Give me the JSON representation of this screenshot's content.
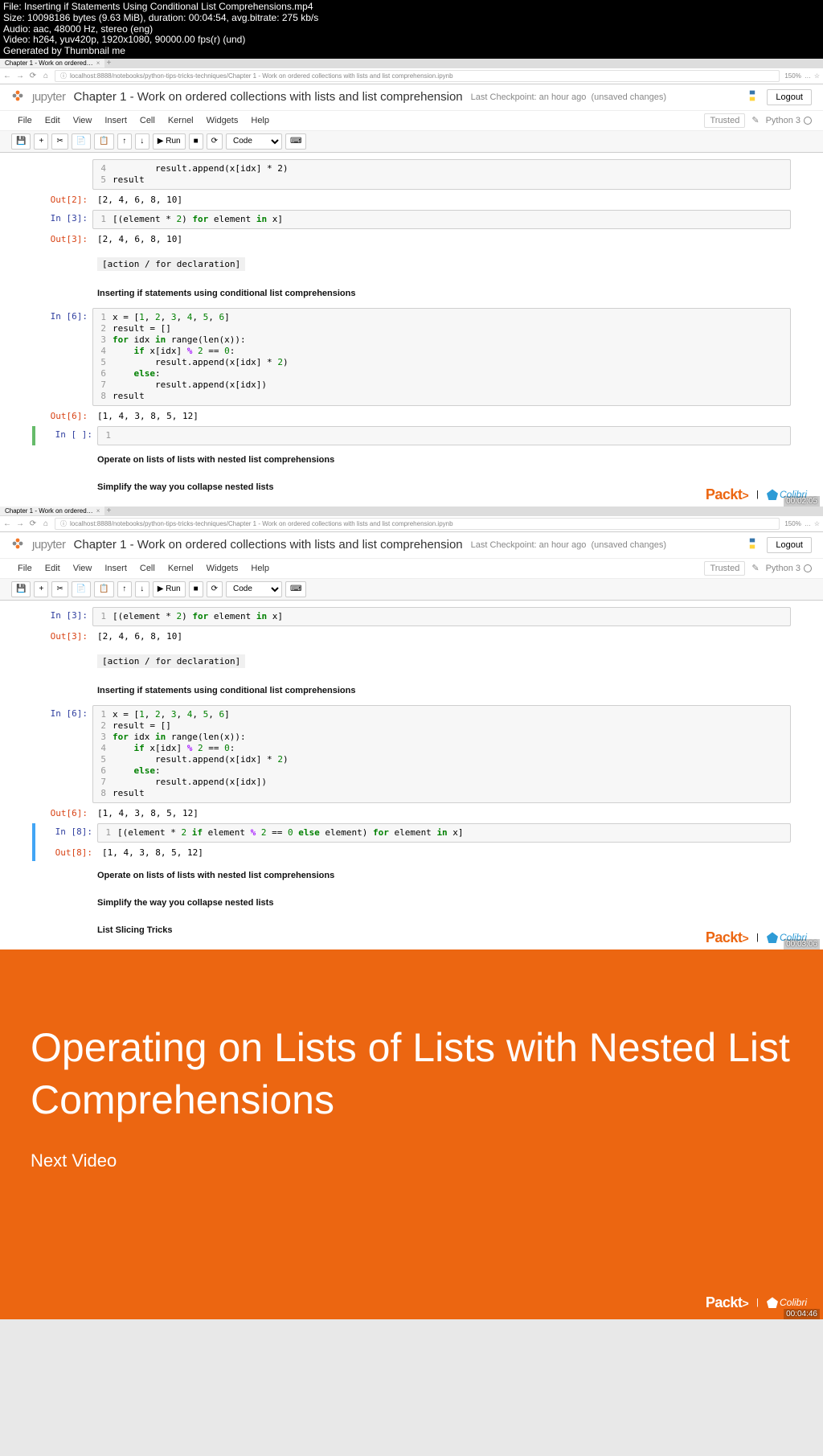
{
  "fileinfo": {
    "file": "File: Inserting if Statements Using Conditional List Comprehensions.mp4",
    "size": "Size: 10098186 bytes (9.63 MiB), duration: 00:04:54, avg.bitrate: 275 kb/s",
    "audio": "Audio: aac, 48000 Hz, stereo (eng)",
    "video": "Video: h264, yuv420p, 1920x1080, 90000.00 fps(r) (und)",
    "gen": "Generated by Thumbnail me"
  },
  "browser": {
    "tab_title": "Chapter 1 - Work on ordered…",
    "tab_close": "×",
    "url": "localhost:8888/notebooks/python-tips-tricks-techniques/Chapter 1 - Work on ordered collections with lists and list comprehension.ipynb",
    "zoom": "150%",
    "new_tab": "+"
  },
  "jupyter": {
    "logo_pre": "ȷupyter",
    "title": "Chapter 1 - Work on ordered collections with lists and list comprehension",
    "checkpoint": "Last Checkpoint: an hour ago",
    "unsaved": "(unsaved changes)",
    "logout": "Logout",
    "menu": [
      "File",
      "Edit",
      "View",
      "Insert",
      "Cell",
      "Kernel",
      "Widgets",
      "Help"
    ],
    "trusted": "Trusted",
    "kernel": "Python 3",
    "toolbar": {
      "run": "▶ Run",
      "cell_type": "Code"
    }
  },
  "shot1": {
    "timestamp": "00:02:05",
    "cell_partial": {
      "gutter": [
        "4",
        "5"
      ],
      "line4": "        result.append(x[idx] * 2)",
      "line5": "result"
    },
    "out2": {
      "prompt": "Out[2]:",
      "text": "[2, 4, 6, 8, 10]"
    },
    "in3": {
      "prompt": "In [3]:",
      "gutter": [
        "1"
      ],
      "line1a": "[(element * ",
      "line1b": "2",
      "line1c": ") ",
      "line1_for": "for",
      "line1d": " element ",
      "line1_in": "in",
      "line1e": " x]"
    },
    "out3": {
      "prompt": "Out[3]:",
      "text": "[2, 4, 6, 8, 10]"
    },
    "md1": "[action / for declaration]",
    "md2": "Inserting if statements using conditional list comprehensions",
    "in6": {
      "prompt": "In [6]:",
      "gutter": [
        "1",
        "2",
        "3",
        "4",
        "5",
        "6",
        "7",
        "8"
      ],
      "l1a": "x = [",
      "l1b": "1",
      "l1c": ", ",
      "l1d": "2",
      "l1e": ", ",
      "l1f": "3",
      "l1g": ", ",
      "l1h": "4",
      "l1i": ", ",
      "l1j": "5",
      "l1k": ", ",
      "l1l": "6",
      "l1m": "]",
      "l2": "result = []",
      "l3_for": "for",
      "l3a": " idx ",
      "l3_in": "in",
      "l3b": " range(len(x)):",
      "l4a": "    ",
      "l4_if": "if",
      "l4b": " x[idx] ",
      "l4_op": "%",
      "l4c": " ",
      "l4d": "2",
      "l4e": " == ",
      "l4f": "0",
      "l4g": ":",
      "l5a": "        result.append(x[idx] * ",
      "l5b": "2",
      "l5c": ")",
      "l6a": "    ",
      "l6_else": "else",
      "l6b": ":",
      "l7": "        result.append(x[idx])",
      "l8": "result"
    },
    "out6": {
      "prompt": "Out[6]:",
      "text": "[1, 4, 3, 8, 5, 12]"
    },
    "in_empty": {
      "prompt": "In [ ]:",
      "gutter": [
        "1"
      ],
      "line": ""
    },
    "md3": "Operate on lists of lists with nested list comprehensions",
    "md4": "Simplify the way you collapse nested lists"
  },
  "shot2": {
    "timestamp": "00:03:06",
    "in3": {
      "prompt": "In [3]:",
      "gutter": [
        "1"
      ],
      "line1a": "[(element * ",
      "line1b": "2",
      "line1c": ") ",
      "line1_for": "for",
      "line1d": " element ",
      "line1_in": "in",
      "line1e": " x]"
    },
    "out3": {
      "prompt": "Out[3]:",
      "text": "[2, 4, 6, 8, 10]"
    },
    "md1": "[action / for declaration]",
    "md2": "Inserting if statements using conditional list comprehensions",
    "in6": {
      "prompt": "In [6]:",
      "gutter": [
        "1",
        "2",
        "3",
        "4",
        "5",
        "6",
        "7",
        "8"
      ]
    },
    "out6": {
      "prompt": "Out[6]:",
      "text": "[1, 4, 3, 8, 5, 12]"
    },
    "in8": {
      "prompt": "In [8]:",
      "gutter": [
        "1"
      ],
      "l1a": "[(element * ",
      "l1b": "2",
      "l1c": " ",
      "l1_if": "if",
      "l1d": " element ",
      "l1_op": "%",
      "l1e": " ",
      "l1f": "2",
      "l1g": " == ",
      "l1h": "0",
      "l1i": " ",
      "l1_else": "else",
      "l1j": " element) ",
      "l1_for": "for",
      "l1k": " element ",
      "l1_in": "in",
      "l1l": " x]"
    },
    "out8": {
      "prompt": "Out[8]:",
      "text": "[1, 4, 3, 8, 5, 12]"
    },
    "md3": "Operate on lists of lists with nested list comprehensions",
    "md4": "Simplify the way you collapse nested lists",
    "md5": "List Slicing Tricks"
  },
  "slide": {
    "title": "Operating on Lists of Lists with Nested List Comprehensions",
    "sub": "Next Video",
    "timestamp": "00:04:46"
  },
  "brand": {
    "packt": "Packt",
    "gt": ">",
    "sep": "|",
    "colibri": "Colibri"
  }
}
